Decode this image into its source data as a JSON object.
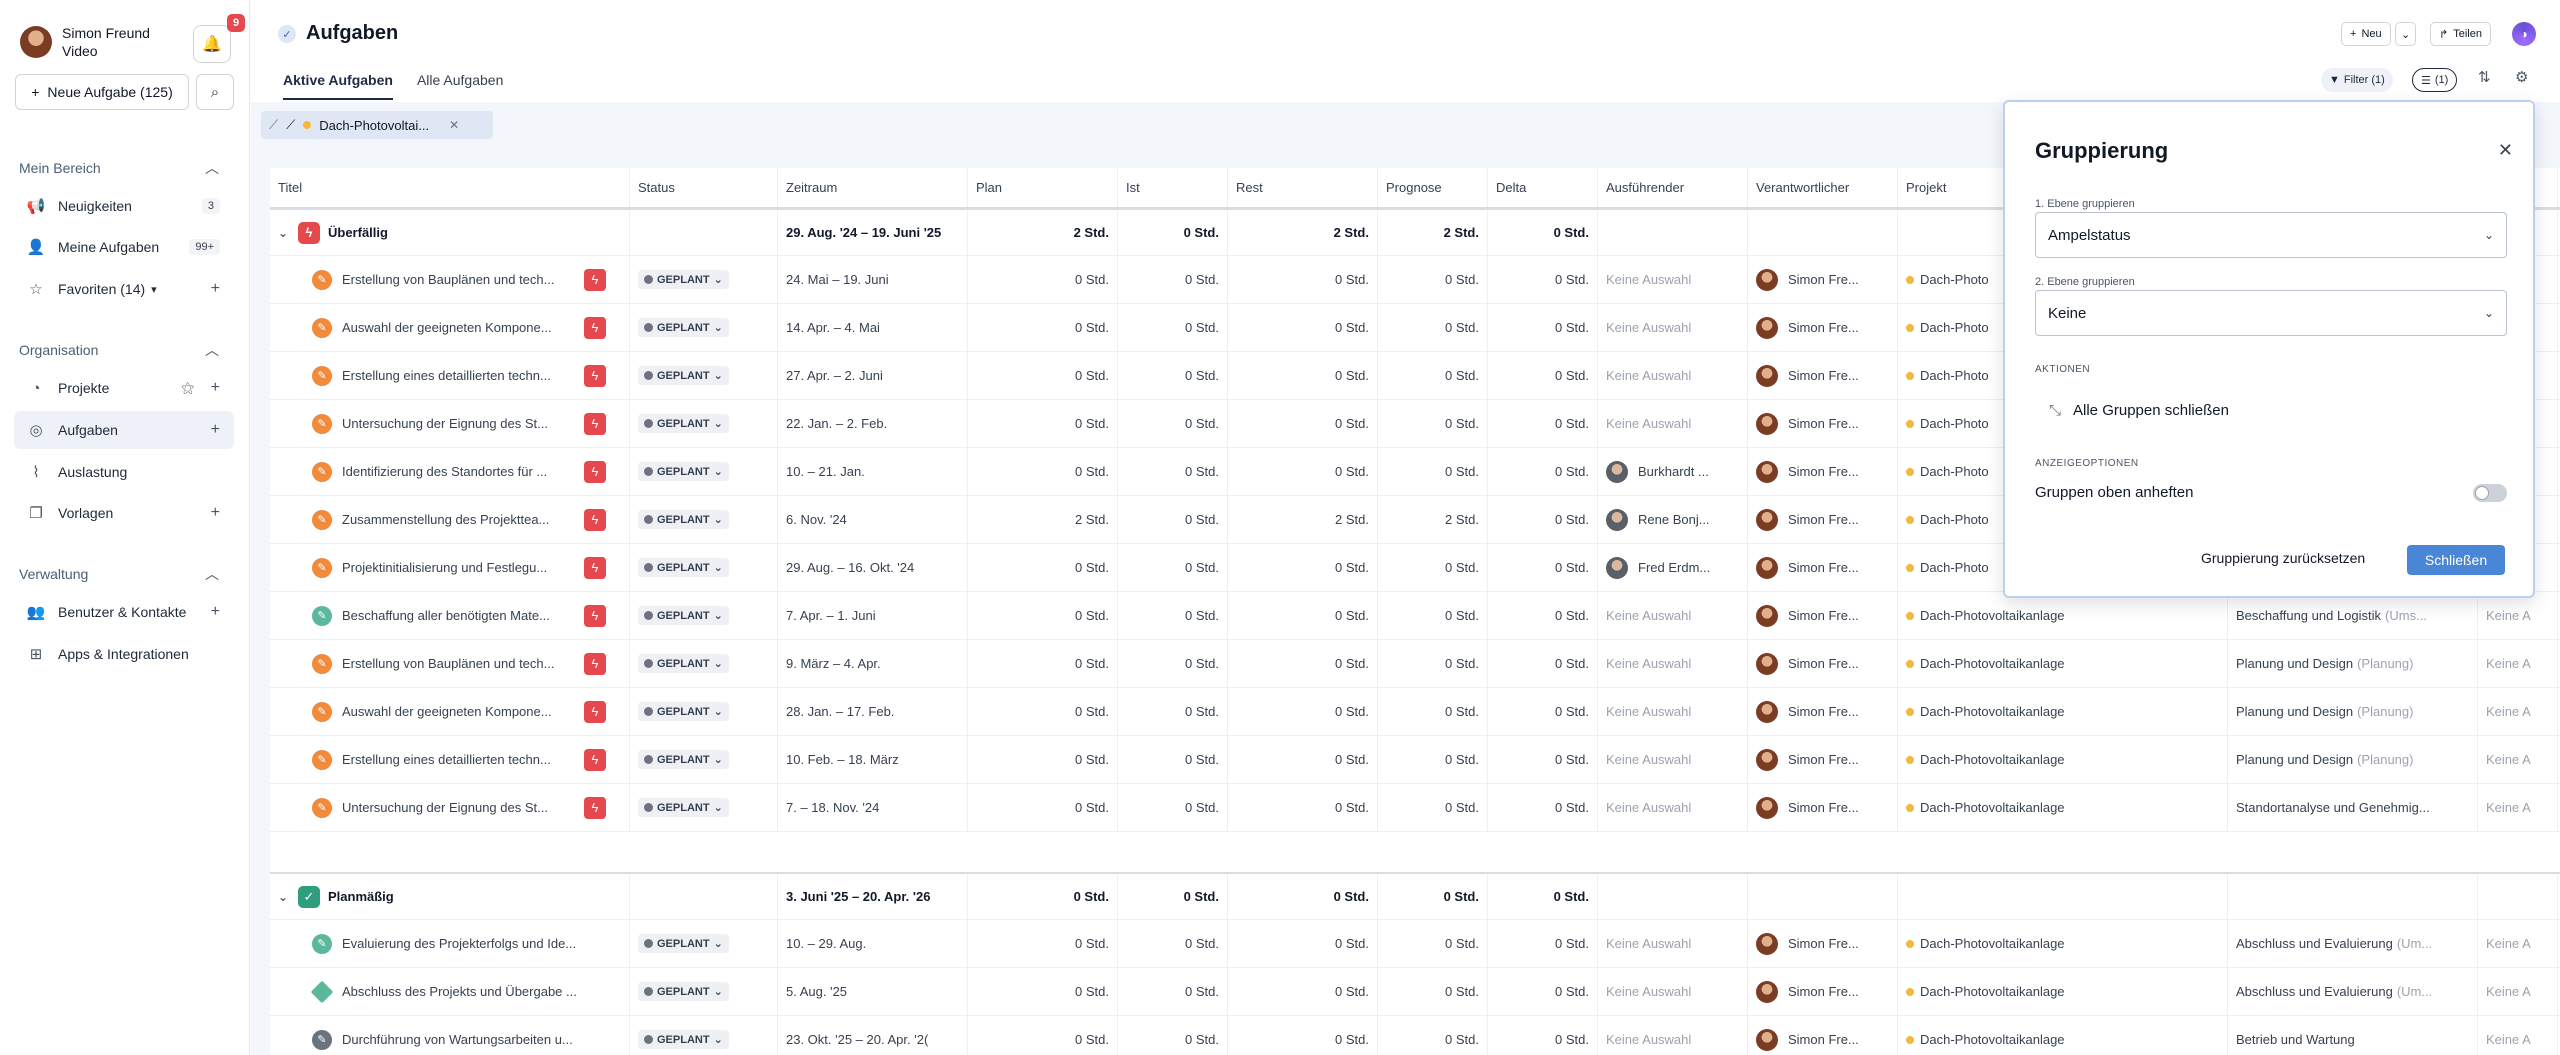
{
  "user": {
    "name": "Simon Freund",
    "role": "Video"
  },
  "notifications": {
    "count": "9"
  },
  "sidebar": {
    "new_task_label": "Neue Aufgabe (125)",
    "sections": [
      {
        "title": "Mein Bereich",
        "items": [
          {
            "label": "Neuigkeiten",
            "badge": "3"
          },
          {
            "label": "Meine Aufgaben",
            "badge": "99+"
          },
          {
            "label": "Favoriten (14)"
          }
        ]
      },
      {
        "title": "Organisation",
        "items": [
          {
            "label": "Projekte"
          },
          {
            "label": "Aufgaben"
          },
          {
            "label": "Auslastung"
          },
          {
            "label": "Vorlagen"
          }
        ]
      },
      {
        "title": "Verwaltung",
        "items": [
          {
            "label": "Benutzer & Kontakte"
          },
          {
            "label": "Apps & Integrationen"
          }
        ]
      }
    ]
  },
  "header": {
    "title": "Aufgaben",
    "tabs": [
      {
        "label": "Aktive Aufgaben"
      },
      {
        "label": "Alle Aufgaben"
      }
    ],
    "new_label": "Neu",
    "share_label": "Teilen",
    "filter_label": "Filter (1)",
    "group_label": "(1)"
  },
  "view_chip": {
    "label": "Dach-Photovoltai..."
  },
  "table": {
    "columns": [
      "Titel",
      "Status",
      "Zeitraum",
      "Plan",
      "Ist",
      "Rest",
      "Prognose",
      "Delta",
      "Ausführender",
      "Verantwortlicher",
      "Projekt"
    ],
    "groups": [
      {
        "name": "Überfällig",
        "range": "29. Aug. '24 – 19. Juni '25",
        "plan": "2 Std.",
        "ist": "0 Std.",
        "rest": "2 Std.",
        "prognose": "2 Std.",
        "delta": "0 Std.",
        "rows": [
          {
            "title": "Erstellung von Bauplänen und tech...",
            "status": "GEPLANT",
            "range": "24. Mai – 19. Juni",
            "plan": "0 Std.",
            "ist": "0 Std.",
            "rest": "0 Std.",
            "prognose": "0 Std.",
            "delta": "0 Std.",
            "assignee": "Keine Auswahl",
            "owner": "Simon Fre...",
            "project": "Dach-Photo"
          },
          {
            "title": "Auswahl der geeigneten Kompone...",
            "status": "GEPLANT",
            "range": "14. Apr. – 4. Mai",
            "plan": "0 Std.",
            "ist": "0 Std.",
            "rest": "0 Std.",
            "prognose": "0 Std.",
            "delta": "0 Std.",
            "assignee": "Keine Auswahl",
            "owner": "Simon Fre...",
            "project": "Dach-Photo"
          },
          {
            "title": "Erstellung eines detaillierten techn...",
            "status": "GEPLANT",
            "range": "27. Apr. – 2. Juni",
            "plan": "0 Std.",
            "ist": "0 Std.",
            "rest": "0 Std.",
            "prognose": "0 Std.",
            "delta": "0 Std.",
            "assignee": "Keine Auswahl",
            "owner": "Simon Fre...",
            "project": "Dach-Photo"
          },
          {
            "title": "Untersuchung der Eignung des St...",
            "status": "GEPLANT",
            "range": "22. Jan. – 2. Feb.",
            "plan": "0 Std.",
            "ist": "0 Std.",
            "rest": "0 Std.",
            "prognose": "0 Std.",
            "delta": "0 Std.",
            "assignee": "Keine Auswahl",
            "owner": "Simon Fre...",
            "project": "Dach-Photo"
          },
          {
            "title": "Identifizierung des Standortes für ...",
            "status": "GEPLANT",
            "range": "10. – 21. Jan.",
            "plan": "0 Std.",
            "ist": "0 Std.",
            "rest": "0 Std.",
            "prognose": "0 Std.",
            "delta": "0 Std.",
            "assignee": "Burkhardt ...",
            "owner": "Simon Fre...",
            "project": "Dach-Photo"
          },
          {
            "title": "Zusammenstellung des Projektteа...",
            "status": "GEPLANT",
            "range": "6. Nov. '24",
            "plan": "2 Std.",
            "ist": "0 Std.",
            "rest": "2 Std.",
            "prognose": "2 Std.",
            "delta": "0 Std.",
            "assignee": "Rene Bonj...",
            "owner": "Simon Fre...",
            "project": "Dach-Photo"
          },
          {
            "title": "Projektinitialisierung und Festlegu...",
            "status": "GEPLANT",
            "range": "29. Aug. – 16. Okt. '24",
            "plan": "0 Std.",
            "ist": "0 Std.",
            "rest": "0 Std.",
            "prognose": "0 Std.",
            "delta": "0 Std.",
            "assignee": "Fred Erdm...",
            "owner": "Simon Fre...",
            "project": "Dach-Photo"
          },
          {
            "title": "Beschaffung aller benötigten Mate...",
            "status": "GEPLANT",
            "range": "7. Apr. – 1. Juni",
            "plan": "0 Std.",
            "ist": "0 Std.",
            "rest": "0 Std.",
            "prognose": "0 Std.",
            "delta": "0 Std.",
            "assignee": "Keine Auswahl",
            "owner": "Simon Fre...",
            "project": "Dach-Photovoltaikanlage",
            "phase": "Beschaffung und Logistik",
            "phase_sub": "(Ums...",
            "extra": "Keine A"
          },
          {
            "title": "Erstellung von Bauplänen und tech...",
            "status": "GEPLANT",
            "range": "9. März – 4. Apr.",
            "plan": "0 Std.",
            "ist": "0 Std.",
            "rest": "0 Std.",
            "prognose": "0 Std.",
            "delta": "0 Std.",
            "assignee": "Keine Auswahl",
            "owner": "Simon Fre...",
            "project": "Dach-Photovoltaikanlage",
            "phase": "Planung und Design",
            "phase_sub": "(Planung)",
            "extra": "Keine A"
          },
          {
            "title": "Auswahl der geeigneten Kompone...",
            "status": "GEPLANT",
            "range": "28. Jan. – 17. Feb.",
            "plan": "0 Std.",
            "ist": "0 Std.",
            "rest": "0 Std.",
            "prognose": "0 Std.",
            "delta": "0 Std.",
            "assignee": "Keine Auswahl",
            "owner": "Simon Fre...",
            "project": "Dach-Photovoltaikanlage",
            "phase": "Planung und Design",
            "phase_sub": "(Planung)",
            "extra": "Keine A"
          },
          {
            "title": "Erstellung eines detaillierten techn...",
            "status": "GEPLANT",
            "range": "10. Feb. – 18. März",
            "plan": "0 Std.",
            "ist": "0 Std.",
            "rest": "0 Std.",
            "prognose": "0 Std.",
            "delta": "0 Std.",
            "assignee": "Keine Auswahl",
            "owner": "Simon Fre...",
            "project": "Dach-Photovoltaikanlage",
            "phase": "Planung und Design",
            "phase_sub": "(Planung)",
            "extra": "Keine A"
          },
          {
            "title": "Untersuchung der Eignung des St...",
            "status": "GEPLANT",
            "range": "7. – 18. Nov. '24",
            "plan": "0 Std.",
            "ist": "0 Std.",
            "rest": "0 Std.",
            "prognose": "0 Std.",
            "delta": "0 Std.",
            "assignee": "Keine Auswahl",
            "owner": "Simon Fre...",
            "project": "Dach-Photovoltaikanlage",
            "phase": "Standortanalyse und Genehmig...",
            "phase_sub": "",
            "extra": "Keine A"
          }
        ]
      },
      {
        "name": "Planmäßig",
        "range": "3. Juni '25 – 20. Apr. '26",
        "plan": "0 Std.",
        "ist": "0 Std.",
        "rest": "0 Std.",
        "prognose": "0 Std.",
        "delta": "0 Std.",
        "rows": [
          {
            "title": "Evaluierung des Projekterfolgs und Ide...",
            "status": "GEPLANT",
            "range": "10. – 29. Aug.",
            "plan": "0 Std.",
            "ist": "0 Std.",
            "rest": "0 Std.",
            "prognose": "0 Std.",
            "delta": "0 Std.",
            "assignee": "Keine Auswahl",
            "owner": "Simon Fre...",
            "project": "Dach-Photovoltaikanlage",
            "phase": "Abschluss und Evaluierung",
            "phase_sub": "(Um...",
            "extra": "Keine A"
          },
          {
            "title": "Abschluss des Projekts und Übergabe ...",
            "status": "GEPLANT",
            "range": "5. Aug. '25",
            "plan": "0 Std.",
            "ist": "0 Std.",
            "rest": "0 Std.",
            "prognose": "0 Std.",
            "delta": "0 Std.",
            "assignee": "Keine Auswahl",
            "owner": "Simon Fre...",
            "project": "Dach-Photovoltaikanlage",
            "phase": "Abschluss und Evaluierung",
            "phase_sub": "(Um...",
            "extra": "Keine A"
          },
          {
            "title": "Durchführung von Wartungsarbeiten u...",
            "status": "GEPLANT",
            "range": "23. Okt. '25 – 20. Apr. '2(",
            "plan": "0 Std.",
            "ist": "0 Std.",
            "rest": "0 Std.",
            "prognose": "0 Std.",
            "delta": "0 Std.",
            "assignee": "Keine Auswahl",
            "owner": "Simon Fre...",
            "project": "Dach-Photovoltaikanlage",
            "phase": "Betrieb und Wartung",
            "phase_sub": "",
            "extra": "Keine A"
          }
        ]
      }
    ]
  },
  "grouping_panel": {
    "title": "Gruppierung",
    "level1_label": "1. Ebene gruppieren",
    "level1_value": "Ampelstatus",
    "level2_label": "2. Ebene gruppieren",
    "level2_value": "Keine",
    "actions_heading": "AKTIONEN",
    "collapse_all_label": "Alle Gruppen schließen",
    "display_heading": "ANZEIGEOPTIONEN",
    "pin_groups_label": "Gruppen oben anheften",
    "reset_label": "Gruppierung zurücksetzen",
    "close_label": "Schließen"
  },
  "colors": {
    "accent": "#4a86d6",
    "overdue": "#e5484d",
    "ontime": "#2f9e7e",
    "project_dot": "#f5b83d"
  }
}
